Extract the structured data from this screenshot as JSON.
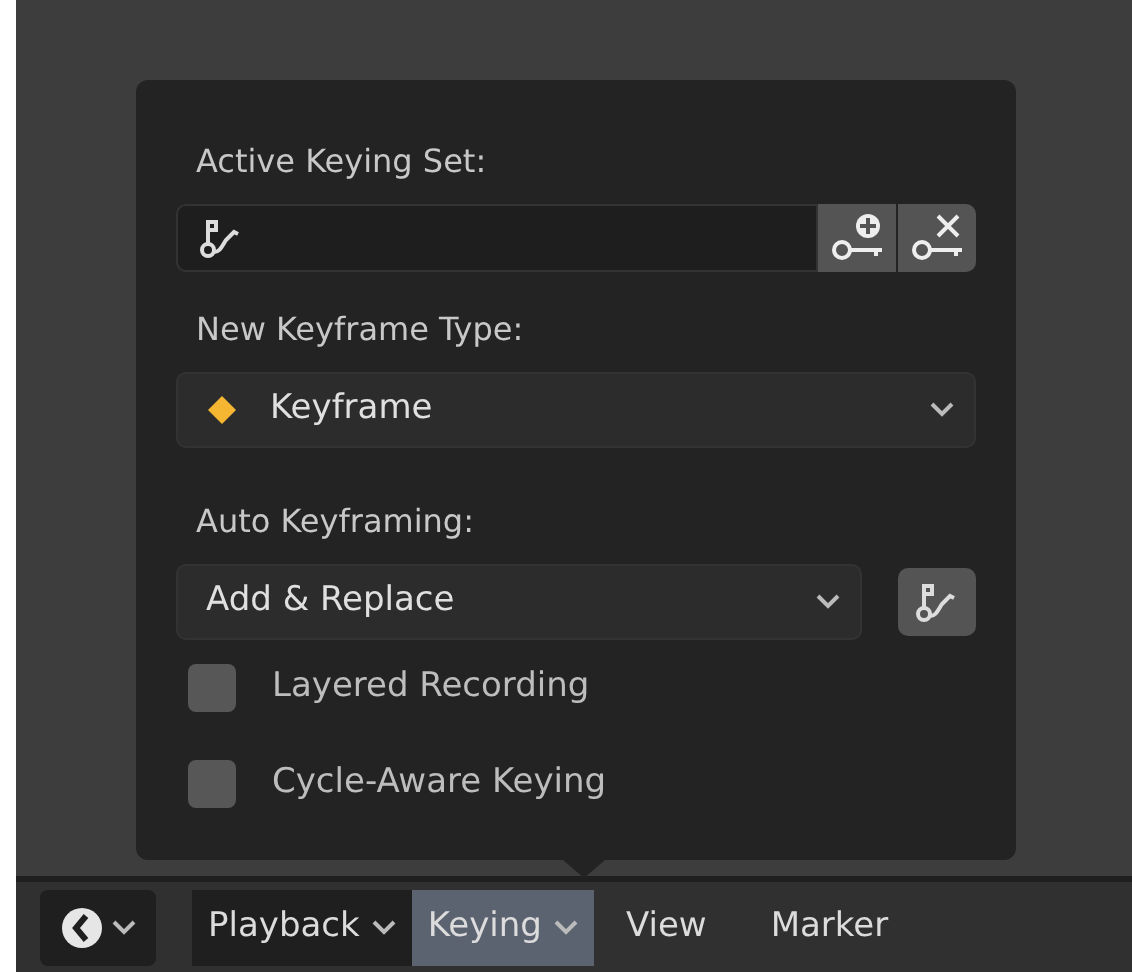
{
  "popover": {
    "active_keying_set": {
      "label": "Active Keying Set:"
    },
    "new_keyframe_type": {
      "label": "New Keyframe Type:",
      "value": "Keyframe"
    },
    "auto_keyframing": {
      "label": "Auto Keyframing:",
      "value": "Add & Replace"
    },
    "options": [
      {
        "label": "Layered Recording",
        "checked": false
      },
      {
        "label": "Cycle-Aware Keying",
        "checked": false
      }
    ]
  },
  "header": {
    "menus": [
      {
        "label": "Playback",
        "kind": "dropdown",
        "selected": false
      },
      {
        "label": "Keying",
        "kind": "dropdown",
        "selected": true
      },
      {
        "label": "View",
        "kind": "plain",
        "selected": false
      },
      {
        "label": "Marker",
        "kind": "plain",
        "selected": false
      }
    ]
  }
}
